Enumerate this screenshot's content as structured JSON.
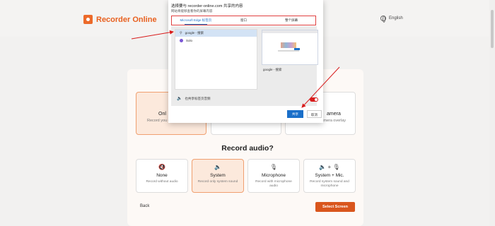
{
  "colors": {
    "brand": "#e8601f",
    "accent_blue": "#1a6fc9",
    "annotation_red": "#d81c1c"
  },
  "app": {
    "name": "Recorder Online",
    "language": "English"
  },
  "dialog": {
    "title": "选择要与 recorder-online.com 共享的内容",
    "subtitle": "网站将能够查看你的屏幕内容",
    "tabs": [
      {
        "label": "Microsoft Edge 标签页",
        "active": true
      },
      {
        "label": "窗口",
        "active": false
      },
      {
        "label": "整个屏幕",
        "active": false
      }
    ],
    "list": [
      {
        "label": "google - 搜索",
        "icon": "search-icon",
        "selected": true
      },
      {
        "label": "Solo",
        "icon": "solo-icon",
        "selected": false
      }
    ],
    "preview_caption": "google - 搜索",
    "audio_label": "也共享标签页音频",
    "share_label": "共享",
    "cancel_label": "取消"
  },
  "record_options": [
    {
      "title": "Onl",
      "desc": "Record you camera",
      "selected": true
    },
    {
      "title": "",
      "desc": "",
      "selected": false
    },
    {
      "title": "amera",
      "desc": "th with camera overlay",
      "selected": false
    }
  ],
  "audio": {
    "title": "Record audio?",
    "options": [
      {
        "icon": "speaker-muted-icon",
        "glyph": "🔇",
        "label": "None",
        "desc": "Record without audio",
        "selected": false
      },
      {
        "icon": "speaker-icon",
        "glyph": "🔈",
        "label": "System",
        "desc": "Record only system sound",
        "selected": true
      },
      {
        "icon": "microphone-icon",
        "glyph": "🎙",
        "label": "Microphone",
        "desc": "Record with microphone audio",
        "selected": false
      },
      {
        "icon": "speaker-mic-icon",
        "glyph": "🔈 + 🎙",
        "label": "System + Mic.",
        "desc": "Record system sound and microphone",
        "selected": false
      }
    ]
  },
  "footer": {
    "back_label": "Back",
    "next_label": "Select Screen"
  }
}
